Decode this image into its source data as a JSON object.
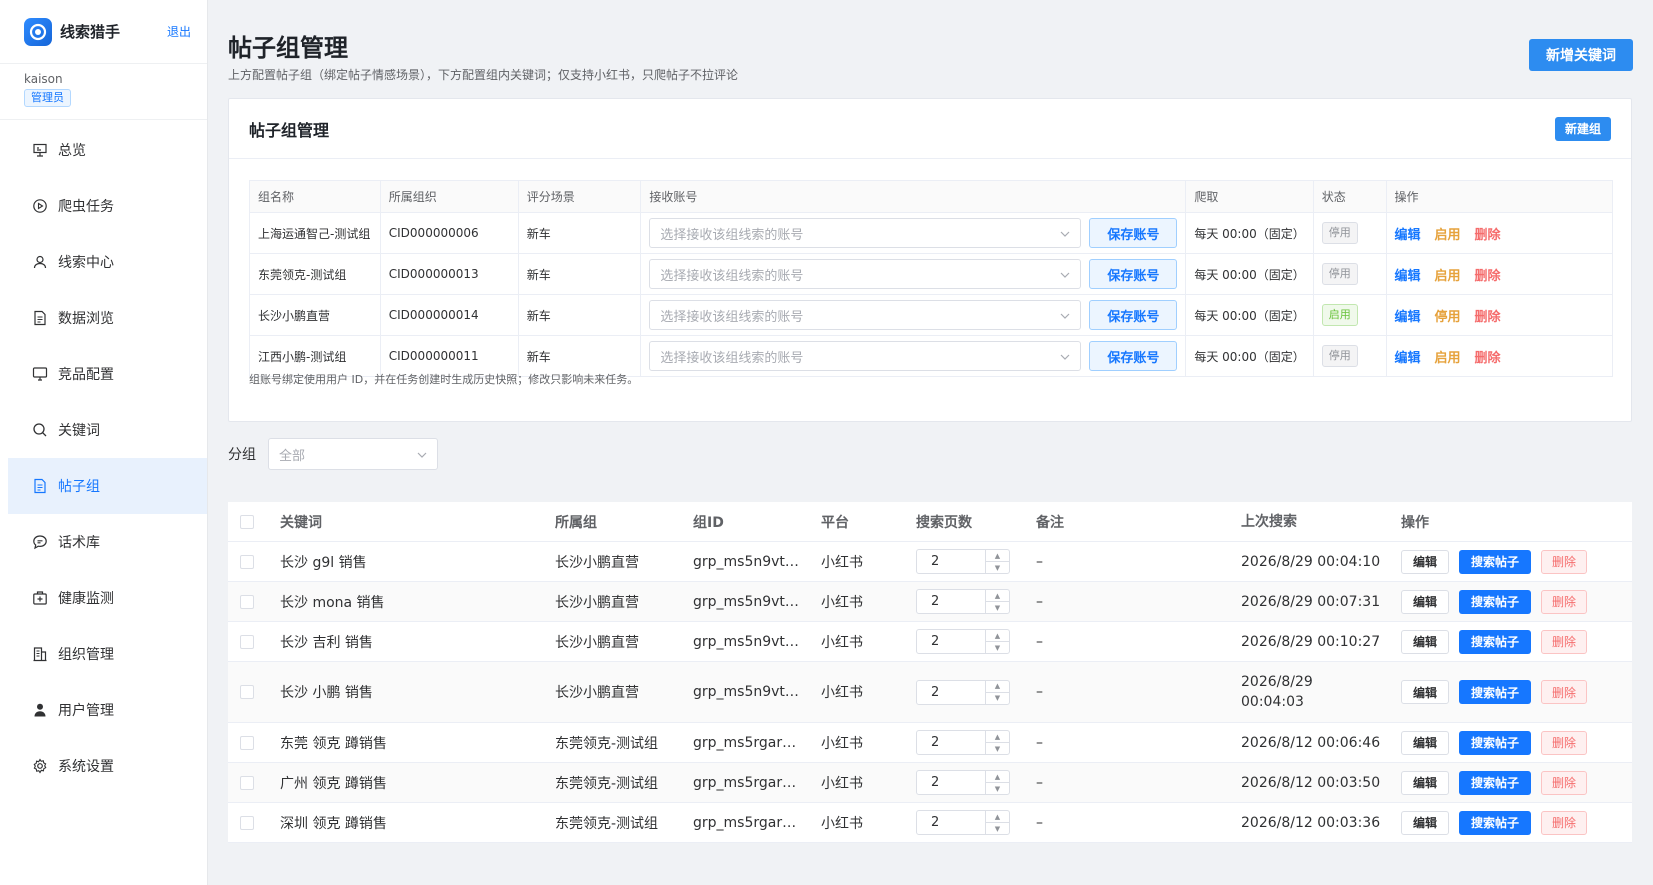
{
  "app": {
    "name": "线索猎手",
    "logout": "退出"
  },
  "user": {
    "name": "kaison",
    "role": "管理员"
  },
  "menu": [
    {
      "label": "总览",
      "icon": "presentation-board-icon"
    },
    {
      "label": "爬虫任务",
      "icon": "play-circle-icon"
    },
    {
      "label": "线索中心",
      "icon": "user-icon"
    },
    {
      "label": "数据浏览",
      "icon": "document-icon"
    },
    {
      "label": "竞品配置",
      "icon": "monitor-icon"
    },
    {
      "label": "关键词",
      "icon": "search-icon"
    },
    {
      "label": "帖子组",
      "icon": "document-list-icon"
    },
    {
      "label": "话术库",
      "icon": "chat-bubble-icon"
    },
    {
      "label": "健康监测",
      "icon": "first-aid-kit-icon"
    },
    {
      "label": "组织管理",
      "icon": "building-icon"
    },
    {
      "label": "用户管理",
      "icon": "user-filled-icon"
    },
    {
      "label": "系统设置",
      "icon": "gear-icon"
    }
  ],
  "active_menu": "帖子组",
  "header": {
    "title": "帖子组管理",
    "subtitle": "上方配置帖子组（绑定帖子情感场景），下方配置组内关键词；仅支持小红书，只爬帖子不拉评论",
    "add_keyword": "新增关键词"
  },
  "group_card": {
    "title": "帖子组管理",
    "new_group": "新建组",
    "columns": [
      "组名称",
      "所属组织",
      "评分场景",
      "接收账号",
      "爬取",
      "状态",
      "操作"
    ],
    "account_placeholder": "选择接收该组线索的账号",
    "save_account": "保存账号",
    "rows": [
      {
        "name": "上海运通智己-测试组",
        "org": "CID000000006",
        "scene": "新车",
        "crawl": "每天 00:00（固定）",
        "status": "停用",
        "status_on": false,
        "toggle": "启用"
      },
      {
        "name": "东莞领克-测试组",
        "org": "CID000000013",
        "scene": "新车",
        "crawl": "每天 00:00（固定）",
        "status": "停用",
        "status_on": false,
        "toggle": "启用"
      },
      {
        "name": "长沙小鹏直营",
        "org": "CID000000014",
        "scene": "新车",
        "crawl": "每天 00:00（固定）",
        "status": "启用",
        "status_on": true,
        "toggle": "停用"
      },
      {
        "name": "江西小鹏-测试组",
        "org": "CID000000011",
        "scene": "新车",
        "crawl": "每天 00:00（固定）",
        "status": "停用",
        "status_on": false,
        "toggle": "启用"
      }
    ],
    "ops": {
      "edit": "编辑",
      "delete": "删除"
    },
    "note": "组账号绑定使用用户 ID，并在任务创建时生成历史快照；修改只影响未来任务。"
  },
  "filter": {
    "label": "分组",
    "value": "全部"
  },
  "keywords": {
    "columns": [
      "关键词",
      "所属组",
      "组ID",
      "平台",
      "搜索页数",
      "备注",
      "上次搜索",
      "操作"
    ],
    "rows": [
      {
        "keyword": "长沙 g9l 销售",
        "group": "长沙小鹏直营",
        "gid": "grp_ms5n9vt…",
        "platform": "小红书",
        "pages": "2",
        "note": "–",
        "last": "2026/8/29 00:04:10"
      },
      {
        "keyword": "长沙 mona 销售",
        "group": "长沙小鹏直营",
        "gid": "grp_ms5n9vt…",
        "platform": "小红书",
        "pages": "2",
        "note": "–",
        "last": "2026/8/29 00:07:31"
      },
      {
        "keyword": "长沙 吉利 销售",
        "group": "长沙小鹏直营",
        "gid": "grp_ms5n9vt…",
        "platform": "小红书",
        "pages": "2",
        "note": "–",
        "last": "2026/8/29 00:10:27"
      },
      {
        "keyword": "长沙 小鹏 销售",
        "group": "长沙小鹏直营",
        "gid": "grp_ms5n9vt…",
        "platform": "小红书",
        "pages": "2",
        "note": "–",
        "last": "2026/8/29 00:04:03"
      },
      {
        "keyword": "东莞 领克 蹲销售",
        "group": "东莞领克-测试组",
        "gid": "grp_ms5rgar…",
        "platform": "小红书",
        "pages": "2",
        "note": "–",
        "last": "2026/8/12 00:06:46"
      },
      {
        "keyword": "广州 领克 蹲销售",
        "group": "东莞领克-测试组",
        "gid": "grp_ms5rgar…",
        "platform": "小红书",
        "pages": "2",
        "note": "–",
        "last": "2026/8/12 00:03:50"
      },
      {
        "keyword": "深圳 领克 蹲销售",
        "group": "东莞领克-测试组",
        "gid": "grp_ms5rgar…",
        "platform": "小红书",
        "pages": "2",
        "note": "–",
        "last": "2026/8/12 00:03:36"
      }
    ],
    "ops": {
      "edit": "编辑",
      "search": "搜索帖子",
      "delete": "删除"
    }
  }
}
